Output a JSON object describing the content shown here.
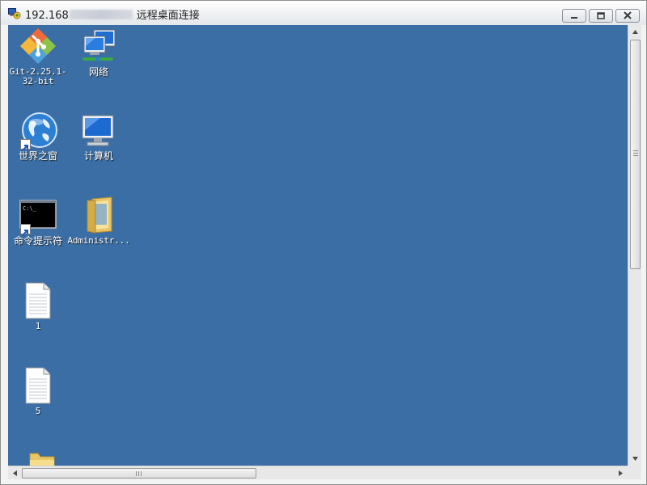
{
  "window": {
    "title_prefix": "192.168",
    "title_suffix": "远程桌面连接",
    "app_icon": "remote-desktop-icon",
    "controls": [
      "minimize-icon",
      "maximize-icon",
      "close-icon"
    ]
  },
  "desktop": {
    "background_color": "#3a6ea5",
    "icons": [
      {
        "id": "git",
        "label": "Git-2.25.1-32-bit",
        "icon": "git-icon",
        "shortcut": false
      },
      {
        "id": "network",
        "label": "网络",
        "icon": "network-icon",
        "shortcut": false
      },
      {
        "id": "world-window",
        "label": "世界之窗",
        "icon": "globe-browser-icon",
        "shortcut": true
      },
      {
        "id": "computer",
        "label": "计算机",
        "icon": "computer-icon",
        "shortcut": false
      },
      {
        "id": "cmd",
        "label": "命令提示符",
        "icon": "command-prompt-icon",
        "shortcut": true
      },
      {
        "id": "administrator",
        "label": "Administr...",
        "icon": "user-folder-icon",
        "shortcut": false
      },
      {
        "id": "file-1",
        "label": "1",
        "icon": "text-file-icon",
        "shortcut": false
      },
      {
        "id": "file-5",
        "label": "5",
        "icon": "text-file-icon",
        "shortcut": false
      },
      {
        "id": "folder-partial",
        "label": "",
        "icon": "folder-icon",
        "shortcut": false
      }
    ]
  },
  "scrollbars": {
    "vertical_position": 0.0,
    "horizontal_position": 0.0
  }
}
